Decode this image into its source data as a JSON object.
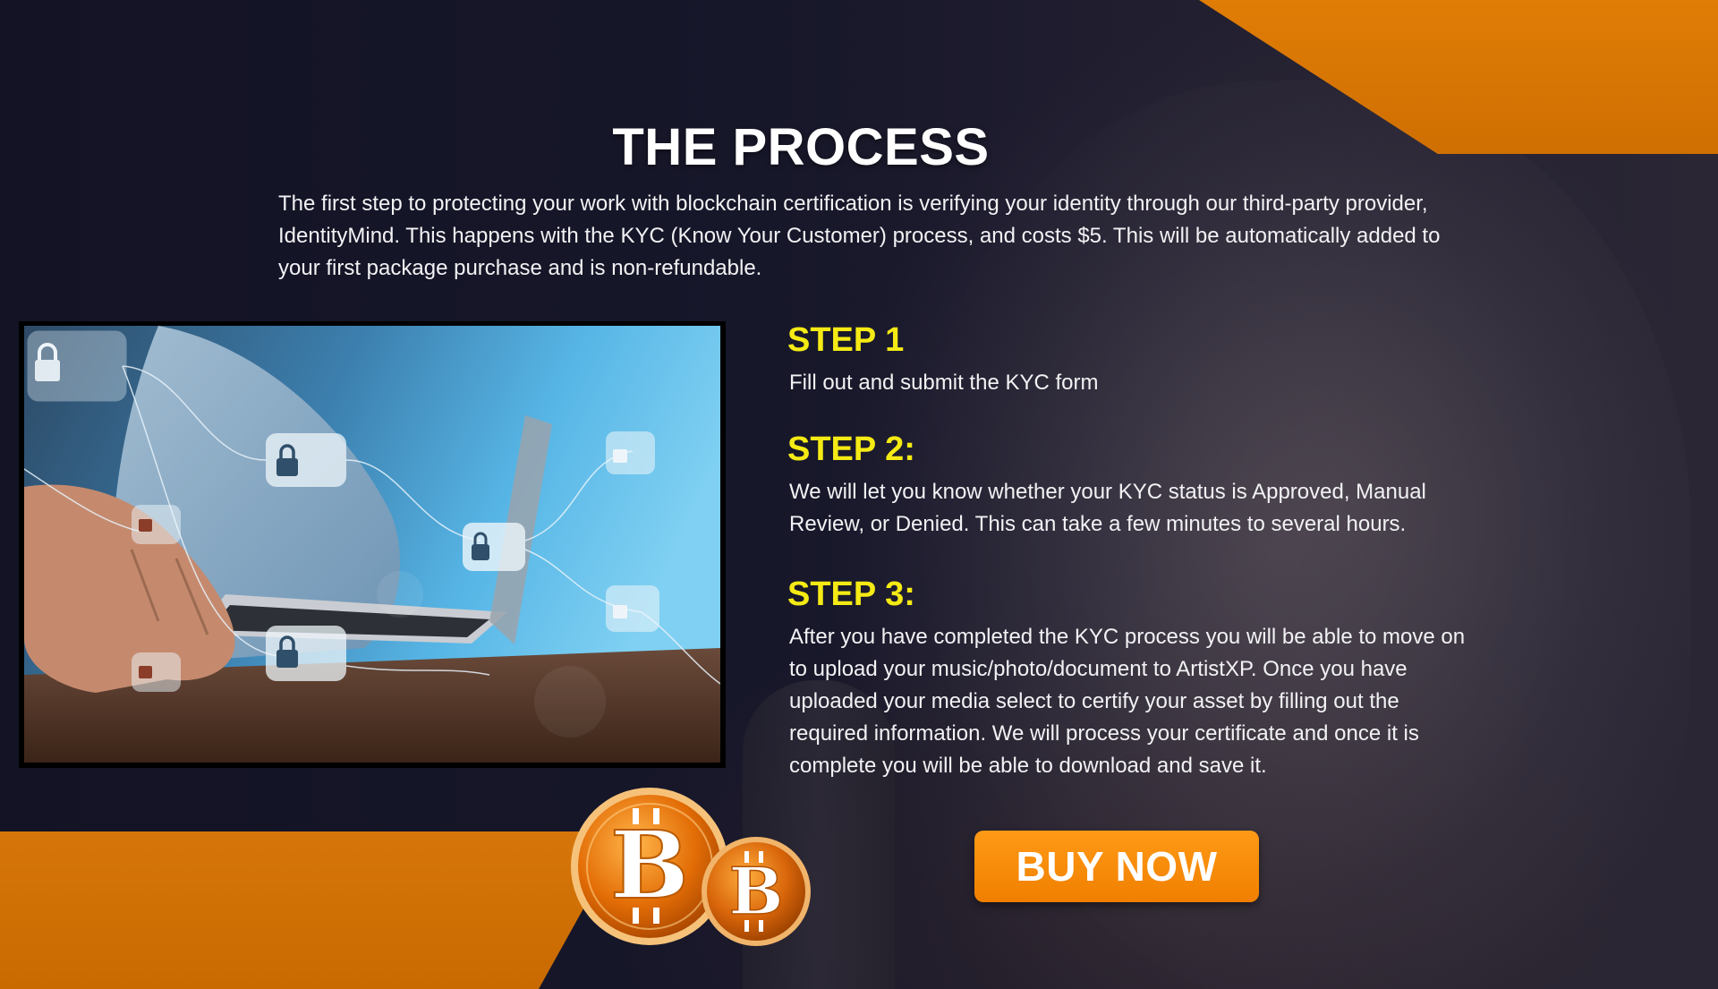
{
  "section": {
    "title": "THE PROCESS",
    "intro": "The first step to protecting your work with blockchain certification is verifying your identity through our third-party provider, IdentityMind. This happens with the KYC (Know Your Customer) process, and costs $5. This will be automatically added to your first package purchase and is non-refundable."
  },
  "steps": [
    {
      "heading": "STEP 1",
      "text": "Fill out and submit the KYC form"
    },
    {
      "heading": "STEP 2:",
      "text": "We will let you know whether your KYC status is Approved, Manual Review, or Denied. This can take a few minutes to several hours."
    },
    {
      "heading": "STEP 3:",
      "text": "After you have completed the KYC process you will be able to move on to upload your music/photo/document to ArtistXP. Once you have uploaded your media select to certify your asset by filling out the required information. We will process your certificate and once it is complete you will be able to download and save it."
    }
  ],
  "cta": {
    "label": "BUY NOW"
  },
  "colors": {
    "accent_orange": "#e07d06",
    "step_yellow": "#f5ea14",
    "background": "#151526",
    "button_orange": "#f88c0a"
  },
  "icons": {
    "coin": "bitcoin-coin-icon",
    "lock": "padlock-icon"
  }
}
